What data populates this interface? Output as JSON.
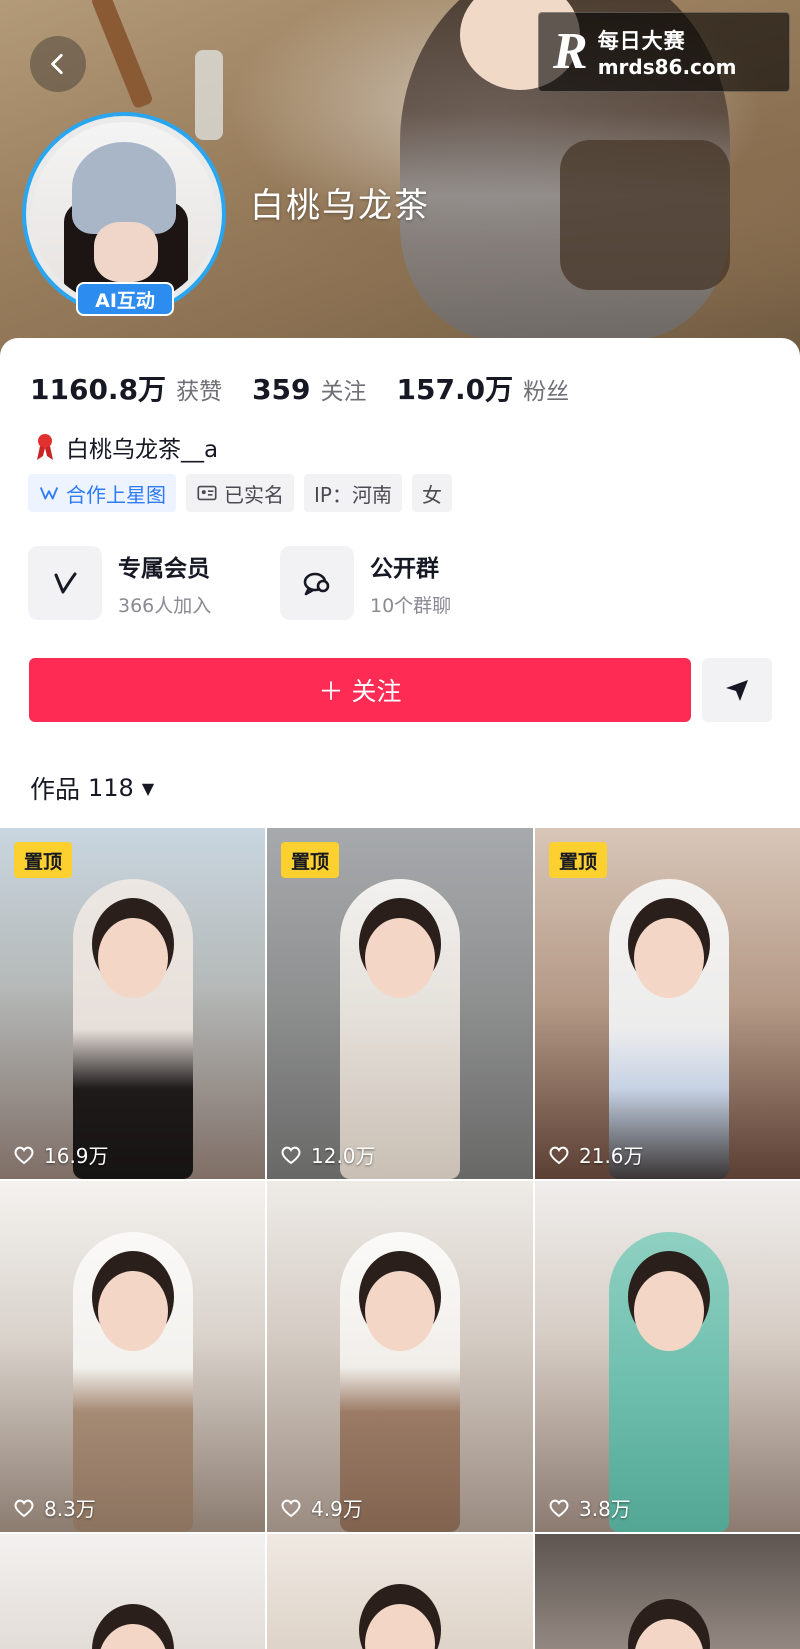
{
  "header": {
    "nickname": "白桃乌龙茶",
    "ai_badge": "AI互动",
    "watermark": {
      "logo": "R",
      "name": "每日大赛",
      "url": "mrds86.com"
    }
  },
  "stats": [
    {
      "value": "1160.8万",
      "label": "获赞"
    },
    {
      "value": "359",
      "label": "关注"
    },
    {
      "value": "157.0万",
      "label": "粉丝"
    }
  ],
  "handle": "白桃乌龙茶__a",
  "tags": [
    {
      "label": "合作上星图",
      "icon": "star-map-icon"
    },
    {
      "label": "已实名",
      "icon": "id-card-icon"
    },
    {
      "label": "IP：河南"
    },
    {
      "label": "女"
    }
  ],
  "features": [
    {
      "title": "专属会员",
      "subtitle": "366人加入",
      "icon": "vip-v-icon"
    },
    {
      "title": "公开群",
      "subtitle": "10个群聊",
      "icon": "chat-bubble-icon"
    }
  ],
  "actions": {
    "follow_label": "＋ 关注"
  },
  "works": {
    "label": "作品",
    "count": "118"
  },
  "videos": [
    {
      "pinned": "置顶",
      "likes": "16.9万"
    },
    {
      "pinned": "置顶",
      "likes": "12.0万"
    },
    {
      "pinned": "置顶",
      "likes": "21.6万"
    },
    {
      "likes": "8.3万"
    },
    {
      "likes": "4.9万"
    },
    {
      "likes": "3.8万"
    }
  ],
  "colors": {
    "accent": "#fe2c55",
    "pin": "#fcd02f",
    "avatar_ring": "#2aa6f0",
    "link_blue": "#2e7bf6"
  }
}
